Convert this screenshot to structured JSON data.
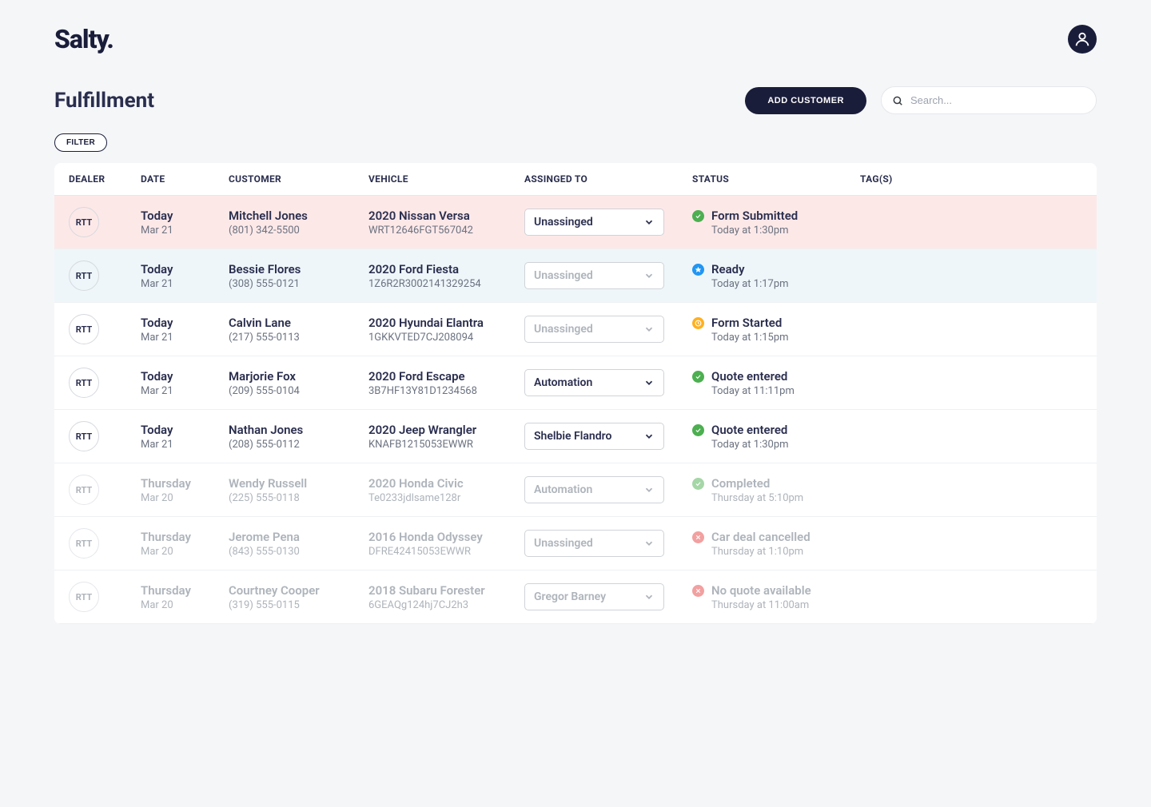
{
  "brand": "Salty.",
  "page_title": "Fulfillment",
  "add_button": "ADD CUSTOMER",
  "search_placeholder": "Search...",
  "filter_button": "FILTER",
  "columns": {
    "dealer": "DEALER",
    "date": "DATE",
    "customer": "CUSTOMER",
    "vehicle": "VEHICLE",
    "assigned": "ASSINGED TO",
    "status": "STATUS",
    "tags": "TAG(S)"
  },
  "rows": [
    {
      "dealer": "RTT",
      "date_primary": "Today",
      "date_secondary": "Mar 21",
      "customer_name": "Mitchell Jones",
      "customer_phone": "(801) 342-5500",
      "vehicle_name": "2020 Nissan Versa",
      "vehicle_vin": "WRT12646FGT567042",
      "assigned": "Unassinged",
      "status_label": "Form Submitted",
      "status_time": "Today at 1:30pm",
      "status_type": "green",
      "highlight": "pink"
    },
    {
      "dealer": "RTT",
      "date_primary": "Today",
      "date_secondary": "Mar 21",
      "customer_name": "Bessie Flores",
      "customer_phone": "(308) 555-0121",
      "vehicle_name": "2020 Ford Fiesta",
      "vehicle_vin": "1Z6R2R3002141329254",
      "assigned": "Unassinged",
      "status_label": "Ready",
      "status_time": "Today at 1:17pm",
      "status_type": "blue",
      "highlight": "blue",
      "assign_disabled": true
    },
    {
      "dealer": "RTT",
      "date_primary": "Today",
      "date_secondary": "Mar 21",
      "customer_name": "Calvin Lane",
      "customer_phone": "(217) 555-0113",
      "vehicle_name": "2020 Hyundai Elantra",
      "vehicle_vin": "1GKKVTED7CJ208094",
      "assigned": "Unassinged",
      "status_label": "Form Started",
      "status_time": "Today at 1:15pm",
      "status_type": "yellow",
      "assign_disabled": true
    },
    {
      "dealer": "RTT",
      "date_primary": "Today",
      "date_secondary": "Mar 21",
      "customer_name": "Marjorie Fox",
      "customer_phone": "(209) 555-0104",
      "vehicle_name": "2020 Ford Escape",
      "vehicle_vin": "3B7HF13Y81D1234568",
      "assigned": "Automation",
      "status_label": "Quote entered",
      "status_time": "Today at 11:11pm",
      "status_type": "green"
    },
    {
      "dealer": "RTT",
      "date_primary": "Today",
      "date_secondary": "Mar 21",
      "customer_name": "Nathan Jones",
      "customer_phone": "(208) 555-0112",
      "vehicle_name": "2020 Jeep Wrangler",
      "vehicle_vin": "KNAFB1215053EWWR",
      "assigned": "Shelbie Flandro",
      "status_label": "Quote entered",
      "status_time": "Today at 1:30pm",
      "status_type": "green"
    },
    {
      "dealer": "RTT",
      "date_primary": "Thursday",
      "date_secondary": "Mar 20",
      "customer_name": "Wendy Russell",
      "customer_phone": "(225) 555-0118",
      "vehicle_name": "2020 Honda Civic",
      "vehicle_vin": "Te0233jdlsame128r",
      "assigned": "Automation",
      "status_label": "Completed",
      "status_time": "Thursday at 5:10pm",
      "status_type": "green-light",
      "faded": true,
      "assign_disabled": true
    },
    {
      "dealer": "RTT",
      "date_primary": "Thursday",
      "date_secondary": "Mar 20",
      "customer_name": "Jerome Pena",
      "customer_phone": "(843) 555-0130",
      "vehicle_name": "2016 Honda Odyssey",
      "vehicle_vin": "DFRE42415053EWWR",
      "assigned": "Unassinged",
      "status_label": "Car deal cancelled",
      "status_time": "Thursday  at 1:10pm",
      "status_type": "red-light",
      "faded": true,
      "assign_disabled": true
    },
    {
      "dealer": "RTT",
      "date_primary": "Thursday",
      "date_secondary": "Mar 20",
      "customer_name": "Courtney Cooper",
      "customer_phone": "(319) 555-0115",
      "vehicle_name": "2018 Subaru Forester",
      "vehicle_vin": "6GEAQg124hj7CJ2h3",
      "assigned": "Gregor Barney",
      "status_label": "No quote available",
      "status_time": "Thursday  at 11:00am",
      "status_type": "red-light",
      "faded": true,
      "assign_disabled": true
    }
  ]
}
